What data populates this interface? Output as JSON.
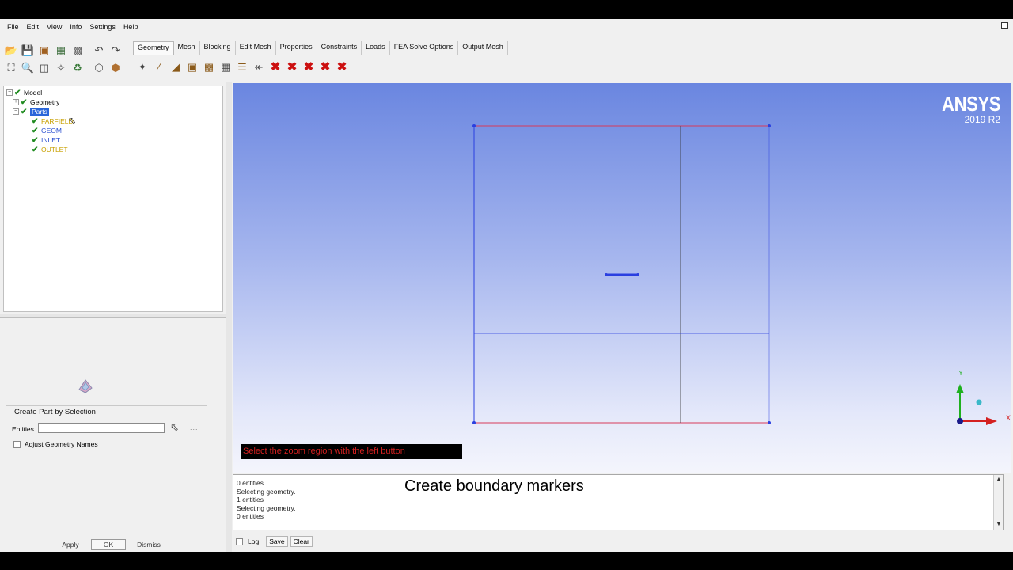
{
  "menu": [
    "File",
    "Edit",
    "View",
    "Info",
    "Settings",
    "Help"
  ],
  "tabs": [
    {
      "label": "Geometry",
      "active": true
    },
    {
      "label": "Mesh"
    },
    {
      "label": "Blocking"
    },
    {
      "label": "Edit Mesh"
    },
    {
      "label": "Properties"
    },
    {
      "label": "Constraints"
    },
    {
      "label": "Loads"
    },
    {
      "label": "FEA Solve Options"
    },
    {
      "label": "Output Mesh"
    }
  ],
  "tree": {
    "model": "Model",
    "geometry": "Geometry",
    "parts": "Parts",
    "children": [
      {
        "label": "FARFIELD",
        "color": "#c8a000"
      },
      {
        "label": "GEOM",
        "color": "#2a4fd0"
      },
      {
        "label": "INLET",
        "color": "#2a4fd0"
      },
      {
        "label": "OUTLET",
        "color": "#c8a000"
      }
    ]
  },
  "panel": {
    "title": "Create Part by Selection",
    "entities_label": "Entities",
    "entities_value": "",
    "more": "...",
    "adjust_label": "Adjust Geometry Names"
  },
  "buttons": {
    "apply": "Apply",
    "ok": "OK",
    "dismiss": "Dismiss"
  },
  "brand": {
    "name": "ANSYS",
    "version": "2019 R2"
  },
  "status": "Select the zoom region with the left button",
  "messages": [
    "0 entities",
    "Selecting geometry.",
    "1 entities",
    "Selecting geometry.",
    "0 entities"
  ],
  "caption": "Create boundary markers",
  "log": {
    "label": "Log",
    "save": "Save",
    "clear": "Clear"
  },
  "axes": {
    "y": "Y",
    "x": "X"
  },
  "colors": {
    "edge_blue": "#2a3fe0",
    "edge_red": "#d83a5a",
    "edge_dark": "#333333",
    "axis_y": "#1fb01f",
    "axis_x": "#d42020"
  }
}
